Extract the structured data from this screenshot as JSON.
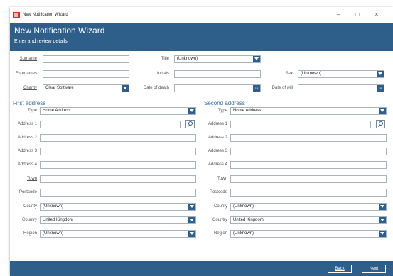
{
  "window": {
    "title": "New Notification Wizard"
  },
  "header": {
    "title": "New Notification Wizard",
    "subtitle": "Enter and review details"
  },
  "details": {
    "surname_label": "Surname",
    "surname_value": "",
    "title_label": "Title",
    "title_value": "(Unknown)",
    "forenames_label": "Forenames",
    "forenames_value": "",
    "initials_label": "Initials",
    "initials_value": "",
    "sex_label": "Sex",
    "sex_value": "(Unknown)",
    "charity_label": "Charity",
    "charity_value": "Clear Software",
    "date_of_death_label": "Date of death",
    "date_of_death_value": "",
    "date_of_will_label": "Date of will",
    "date_of_will_value": "",
    "date_button": "15"
  },
  "first_address": {
    "heading": "First address",
    "type_label": "Type",
    "type_value": "Home Address",
    "address1_label": "Address 1",
    "address1_value": "",
    "address2_label": "Address 2",
    "address2_value": "",
    "address3_label": "Address 3",
    "address3_value": "",
    "address4_label": "Address 4",
    "address4_value": "",
    "town_label": "Town",
    "town_value": "",
    "postcode_label": "Postcode",
    "postcode_value": "",
    "county_label": "County",
    "county_value": "(Unknown)",
    "country_label": "Country",
    "country_value": "United Kingdom",
    "region_label": "Region",
    "region_value": "(Unknown)"
  },
  "second_address": {
    "heading": "Second address",
    "type_label": "Type",
    "type_value": "Home Address",
    "address1_label": "Address 1",
    "address1_value": "",
    "address2_label": "Address 2",
    "address2_value": "",
    "address3_label": "Address 3",
    "address3_value": "",
    "address4_label": "Address 4",
    "address4_value": "",
    "town_label": "Town",
    "town_value": "",
    "postcode_label": "Postcode",
    "postcode_value": "",
    "county_label": "County",
    "county_value": "(Unknown)",
    "country_label": "Country",
    "country_value": "United Kingdom",
    "region_label": "Region",
    "region_value": "(Unknown)"
  },
  "footer": {
    "back_label": "Back",
    "next_label": "Next"
  },
  "colors": {
    "accent": "#2e5f8a",
    "section_heading": "#3a6e9b"
  },
  "icons": {
    "app": "app-icon",
    "search": "search-icon",
    "dropdown": "chevron-down-icon",
    "calendar": "calendar-icon"
  }
}
